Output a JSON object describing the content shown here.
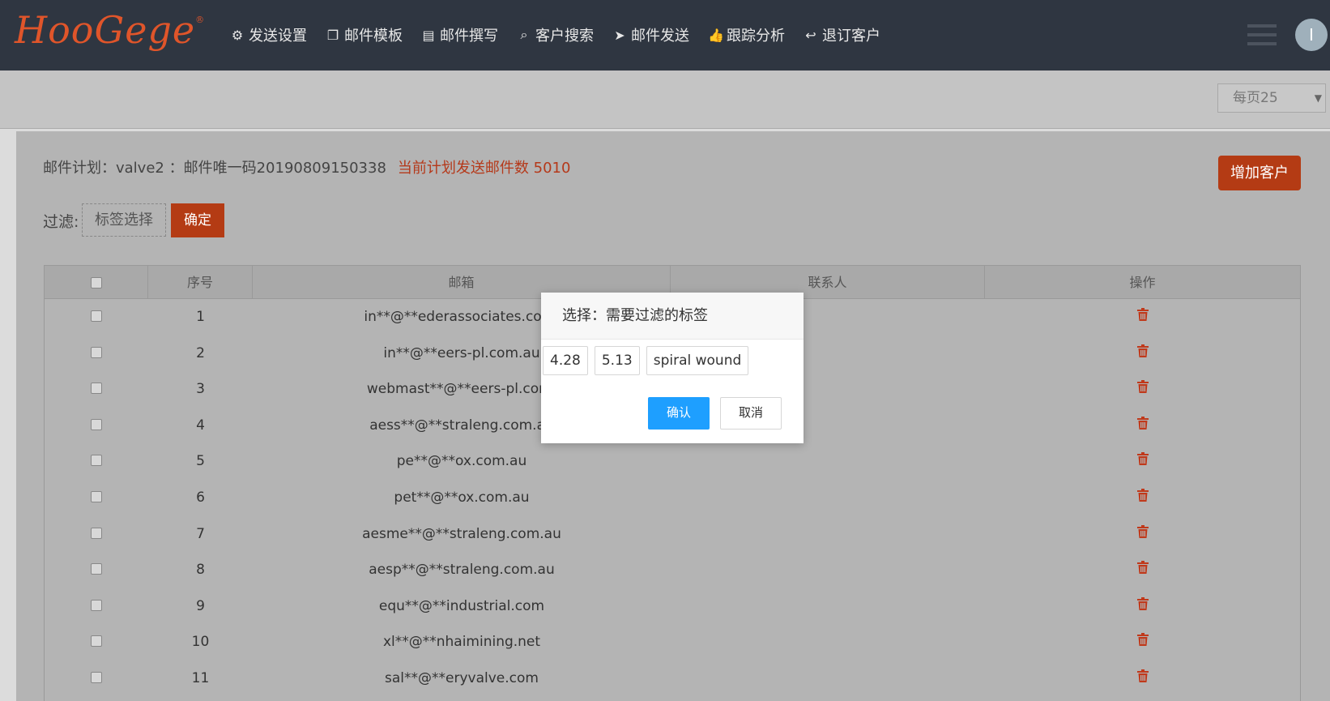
{
  "brand": {
    "logo_text": "HooGege",
    "reg_mark": "®",
    "accent_color": "#e0552a"
  },
  "nav": [
    {
      "label": "发送设置",
      "icon": "gear-icon",
      "glyph": "⚙"
    },
    {
      "label": "邮件模板",
      "icon": "copy-icon",
      "glyph": "❐"
    },
    {
      "label": "邮件撰写",
      "icon": "file-icon",
      "glyph": "▤"
    },
    {
      "label": "客户搜索",
      "icon": "search-icon",
      "glyph": "⌕"
    },
    {
      "label": "邮件发送",
      "icon": "send-icon",
      "glyph": "➤"
    },
    {
      "label": "跟踪分析",
      "icon": "thumbs-up-icon",
      "glyph": "👍"
    },
    {
      "label": "退订客户",
      "icon": "reply-icon",
      "glyph": "↩"
    }
  ],
  "user": {
    "avatar_initial": "I"
  },
  "per_page": {
    "value": "每页25",
    "caret": "▼"
  },
  "plan": {
    "text": "邮件计划：valve2 ：邮件唯一码20190809150338",
    "count_text": "当前计划发送邮件数 5010"
  },
  "add_button": "增加客户",
  "filter": {
    "label": "过滤:",
    "tag_select": "标签选择",
    "confirm": "确定"
  },
  "table": {
    "headers": [
      "",
      "序号",
      "邮箱",
      "联系人",
      "操作"
    ],
    "rows": [
      {
        "no": "1",
        "email": "in**@**ederassociates.com.",
        "contact": ""
      },
      {
        "no": "2",
        "email": "in**@**eers-pl.com.au",
        "contact": ""
      },
      {
        "no": "3",
        "email": "webmast**@**eers-pl.com.",
        "contact": ""
      },
      {
        "no": "4",
        "email": "aess**@**straleng.com.au",
        "contact": ""
      },
      {
        "no": "5",
        "email": "pe**@**ox.com.au",
        "contact": ""
      },
      {
        "no": "6",
        "email": "pet**@**ox.com.au",
        "contact": ""
      },
      {
        "no": "7",
        "email": "aesme**@**straleng.com.au",
        "contact": ""
      },
      {
        "no": "8",
        "email": "aesp**@**straleng.com.au",
        "contact": ""
      },
      {
        "no": "9",
        "email": "equ**@**industrial.com",
        "contact": ""
      },
      {
        "no": "10",
        "email": "xl**@**nhaimining.net",
        "contact": ""
      },
      {
        "no": "11",
        "email": "sal**@**eryvalve.com",
        "contact": ""
      }
    ],
    "delete_icon_color": "#c0391b"
  },
  "dialog": {
    "title": "选择：需要过滤的标签",
    "tags": [
      "4.28",
      "5.13",
      "spiral wound"
    ],
    "confirm": "确认",
    "cancel": "取消",
    "confirm_color": "#1e9fff"
  }
}
